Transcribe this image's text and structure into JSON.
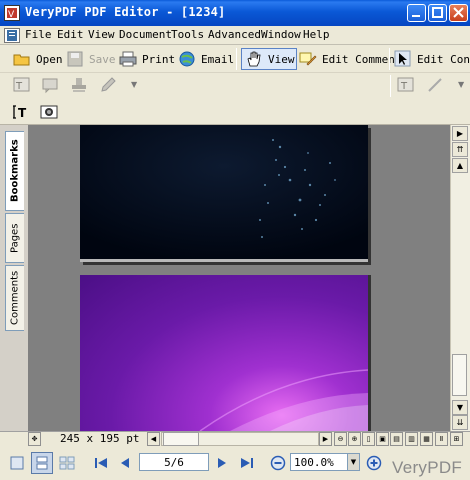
{
  "window": {
    "title": "VeryPDF PDF Editor - [1234]",
    "app_icon": "verypdf-logo-icon"
  },
  "menu": {
    "items": [
      "File",
      "Edit",
      "View",
      "Document",
      "Tools",
      "Advanced",
      "Window",
      "Help"
    ]
  },
  "toolbar": {
    "open_label": "Open",
    "save_label": "Save",
    "print_label": "Print",
    "email_label": "Email",
    "view_label": "View",
    "edit_comment_label": "Edit Comment",
    "edit_content_label": "Edit Conte"
  },
  "sidebar": {
    "tabs": [
      "Bookmarks",
      "Pages",
      "Comments"
    ],
    "active_tab": "Bookmarks"
  },
  "status": {
    "page_size": "245 x 195 pt"
  },
  "nav": {
    "page": "5/6",
    "zoom": "100.0%"
  },
  "watermark": "VeryPDF",
  "colors": {
    "titlebar": "#0a58d6",
    "page1_bg": "#000b1c",
    "page2_purple": "#6a1aa8",
    "doc_bg": "#808080"
  }
}
